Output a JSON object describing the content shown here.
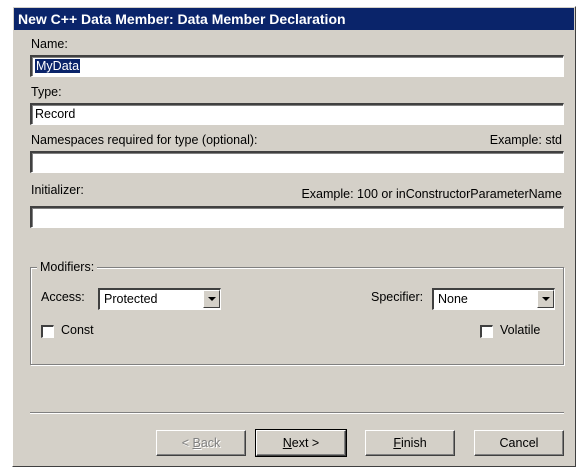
{
  "window": {
    "title": "New C++ Data Member: Data Member Declaration"
  },
  "form": {
    "name_label": "Name:",
    "name_value": "MyData",
    "type_label": "Type:",
    "type_value": "Record",
    "namespaces_label": "Namespaces required for type (optional):",
    "namespaces_example": "Example: std",
    "namespaces_value": "",
    "initializer_label": "Initializer:",
    "initializer_example": "Example: 100 or inConstructorParameterName",
    "initializer_value": ""
  },
  "modifiers": {
    "group_label": "Modifiers:",
    "access_label": "Access:",
    "access_value": "Protected",
    "specifier_label": "Specifier:",
    "specifier_value": "None",
    "const_label": "Const",
    "const_checked": false,
    "volatile_label": "Volatile",
    "volatile_checked": false
  },
  "buttons": {
    "back_prefix": "< ",
    "back_accel": "B",
    "back_rest": "ack",
    "next_accel": "N",
    "next_rest": "ext >",
    "finish_accel": "F",
    "finish_rest": "inish",
    "cancel": "Cancel"
  },
  "colors": {
    "titlebar": "#0a246a",
    "face": "#d4d0c8"
  }
}
